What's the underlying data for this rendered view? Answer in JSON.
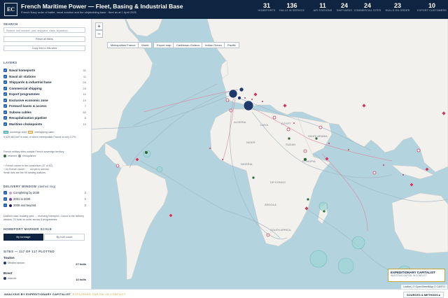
{
  "header": {
    "logo": "EC",
    "title": "French Maritime Power — Fleet, Basing & Industrial Base",
    "subtitle": "French Navy order of battle, naval aviation and the shipbuilding base · fleet as at 1 April 2025",
    "stats": [
      {
        "value": "31",
        "label": "HOMEPORTS"
      },
      {
        "value": "136",
        "label": "HULLS IN SERVICE"
      },
      {
        "value": "11",
        "label": "AIR STATIONS"
      },
      {
        "value": "24",
        "label": "SHIPYARDS"
      },
      {
        "value": "24",
        "label": "COMMERCIAL SITES"
      },
      {
        "value": "23",
        "label": "HULLS ON ORDER"
      },
      {
        "value": "10",
        "label": "EXPORT CUSTOMERS"
      }
    ]
  },
  "sidebar": {
    "search_heading": "SEARCH",
    "search_placeholder": "Search: hull number, port, shipyard, class, squadron…",
    "reset_label": "Reset all filters",
    "copy_label": "Copy link to this view",
    "layers_heading": "LAYERS",
    "layers": [
      {
        "label": "Naval homeports",
        "count": "31"
      },
      {
        "label": "Naval air stations",
        "count": "11"
      },
      {
        "label": "Shipyards & industrial base",
        "count": "24"
      },
      {
        "label": "Commercial shipping",
        "count": "24"
      },
      {
        "label": "Export programmes",
        "count": "10"
      },
      {
        "label": "Exclusive economic zone",
        "count": "19"
      },
      {
        "label": "Forward bases & access",
        "count": "7"
      },
      {
        "label": "Subsea cables",
        "count": "62"
      },
      {
        "label": "Recapitalisation pipeline",
        "count": "8"
      },
      {
        "label": "Maritime chokepoints",
        "count": "10"
      }
    ],
    "eez_legend": {
      "sovereign": "sovereign zone",
      "overlapping": "overlapping claim"
    },
    "eez_note": "9,529,464 km² in total, of which metropolitan France is only 3.7%.",
    "military_note": "French military sites outside French sovereign territory",
    "retained": "retained",
    "relinquished": "relinquished",
    "cable_note": "French owner in the consortium (37 of 62)",
    "cable_note2": "no French owner · · · not yet in service",
    "cable_note3": "Small dots are the 99 landing stations.",
    "delivery_heading": "DELIVERY WINDOW",
    "delivery_hint": "(dashed ring)",
    "delivery": [
      {
        "label": "Completing by 2030",
        "count": "3"
      },
      {
        "label": "2031 to 2035",
        "count": "2"
      },
      {
        "label": "2036 and beyond",
        "count": "3"
      }
    ],
    "delivery_note": "Dashed rows: building yard → receiving homeport. Colour is the delivery window. 23 hulls on order across 8 programmes.",
    "scale_heading": "HOMEPORT MARKER SCALE",
    "scale_options": [
      "By tonnage",
      "By hull count"
    ],
    "sites_heading": "SITES — 117 OF 117 PLOTTED",
    "sites": [
      {
        "name": "Toulon",
        "sub": "Mediterranean",
        "value": "27 hulls"
      },
      {
        "name": "Brest",
        "sub": "Atlantic",
        "value": "14 hulls"
      }
    ]
  },
  "map": {
    "zoom_in": "+",
    "zoom_out": "−",
    "views": [
      "Metropolitan France",
      "World",
      "Export map",
      "Caribbean-Guiana",
      "Indian Ocean",
      "Pacific"
    ],
    "labels": [
      "NIGER",
      "NIGERIA",
      "SUDAN",
      "ETHIOPIA",
      "DR CONGO",
      "ANGOLA",
      "EGYPT",
      "LIBYA",
      "ALGERIA",
      "SAUDI ARABIA",
      "SOUTH AFRICA"
    ],
    "attribution": "Leaflet | © OpenStreetMap © CARTO",
    "watermark_title": "EXPEDITIONARY CAPITALIST",
    "watermark_sub": "INVESTING CAPITAL IN CONFLICT"
  },
  "footer": {
    "credit": "ANALYSIS BY EXPEDITIONARY CAPITALIST",
    "tagline": "EXPLORING CAPITAL IN CONFLICT",
    "sources": "SOURCES & METHODS"
  },
  "colors": {
    "header": "#0f2440",
    "accent": "#1f5fb0",
    "ocean": "#b3d3df",
    "land": "#f3f1ed",
    "eez": "#5fb4b8",
    "cable": "#a3b7c4",
    "export": "#c53c5e"
  }
}
